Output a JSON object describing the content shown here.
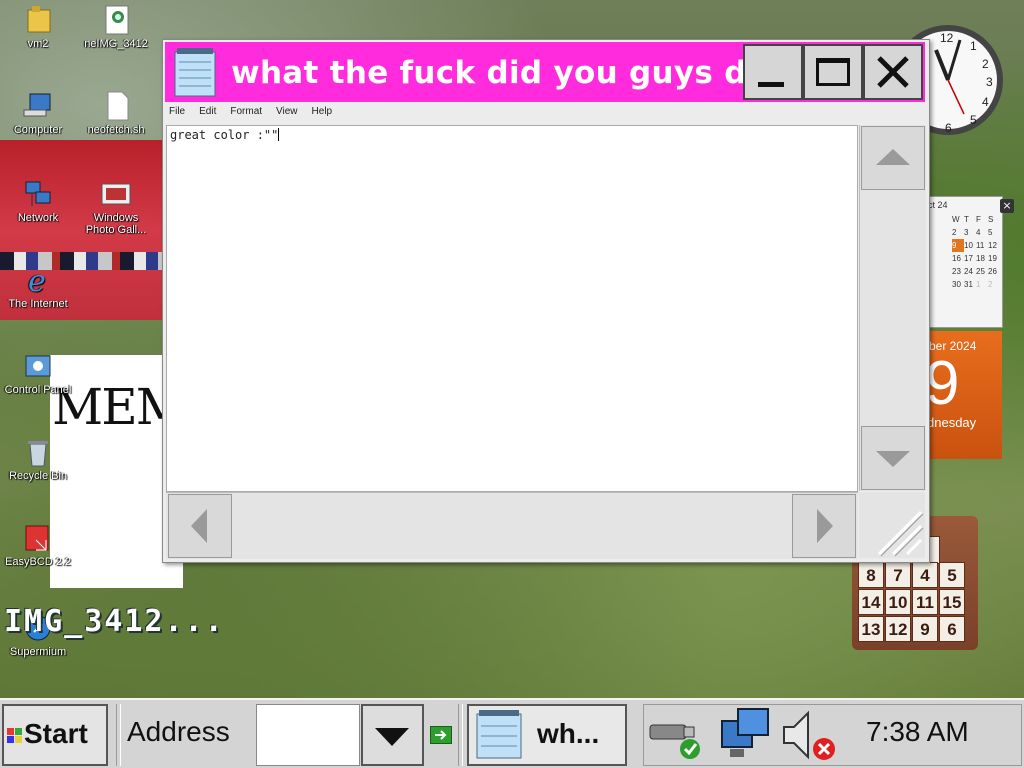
{
  "desktop": {
    "icons": [
      {
        "label": "vm2"
      },
      {
        "label": "neIMG_3412"
      },
      {
        "label": "Computer"
      },
      {
        "label": "neofetch.sh"
      },
      {
        "label": "Network"
      },
      {
        "label": "Windows Photo Gall..."
      },
      {
        "label": "The Internet"
      },
      {
        "label": "Control Panel"
      },
      {
        "label": "Recycle Bin"
      },
      {
        "label": "EasyBCD 2.2"
      },
      {
        "label": "Supermium"
      }
    ],
    "image_label": "IMG_3412...",
    "memo_text": "MEM"
  },
  "calendar": {
    "month_label": "ct 24",
    "weekdays": [
      "W",
      "T",
      "F",
      "S"
    ],
    "days": [
      "2",
      "3",
      "4",
      "5",
      "9",
      "10",
      "11",
      "12",
      "16",
      "17",
      "18",
      "19",
      "23",
      "24",
      "25",
      "26",
      "30",
      "31",
      "1",
      "2"
    ],
    "today": "9",
    "bottom_month": "ber 2024",
    "big_day": "9",
    "weekday": "dnesday",
    "close": "×"
  },
  "puzzle": {
    "top_tile": "3",
    "tiles": [
      "8",
      "7",
      "4",
      "5",
      "14",
      "10",
      "11",
      "15",
      "13",
      "12",
      "9",
      "6"
    ]
  },
  "notepad": {
    "title": "what the fuck did you guys d...",
    "menu": [
      "File",
      "Edit",
      "Format",
      "View",
      "Help"
    ],
    "content": "great color :\"\""
  },
  "taskbar": {
    "start_label": "Start",
    "address_label": "Address",
    "address_value": "",
    "task_label": "wh...",
    "time": "7:38 AM"
  },
  "colors": {
    "titlebar": "#ff2bdc",
    "taskbar": "#d4d4d4"
  }
}
